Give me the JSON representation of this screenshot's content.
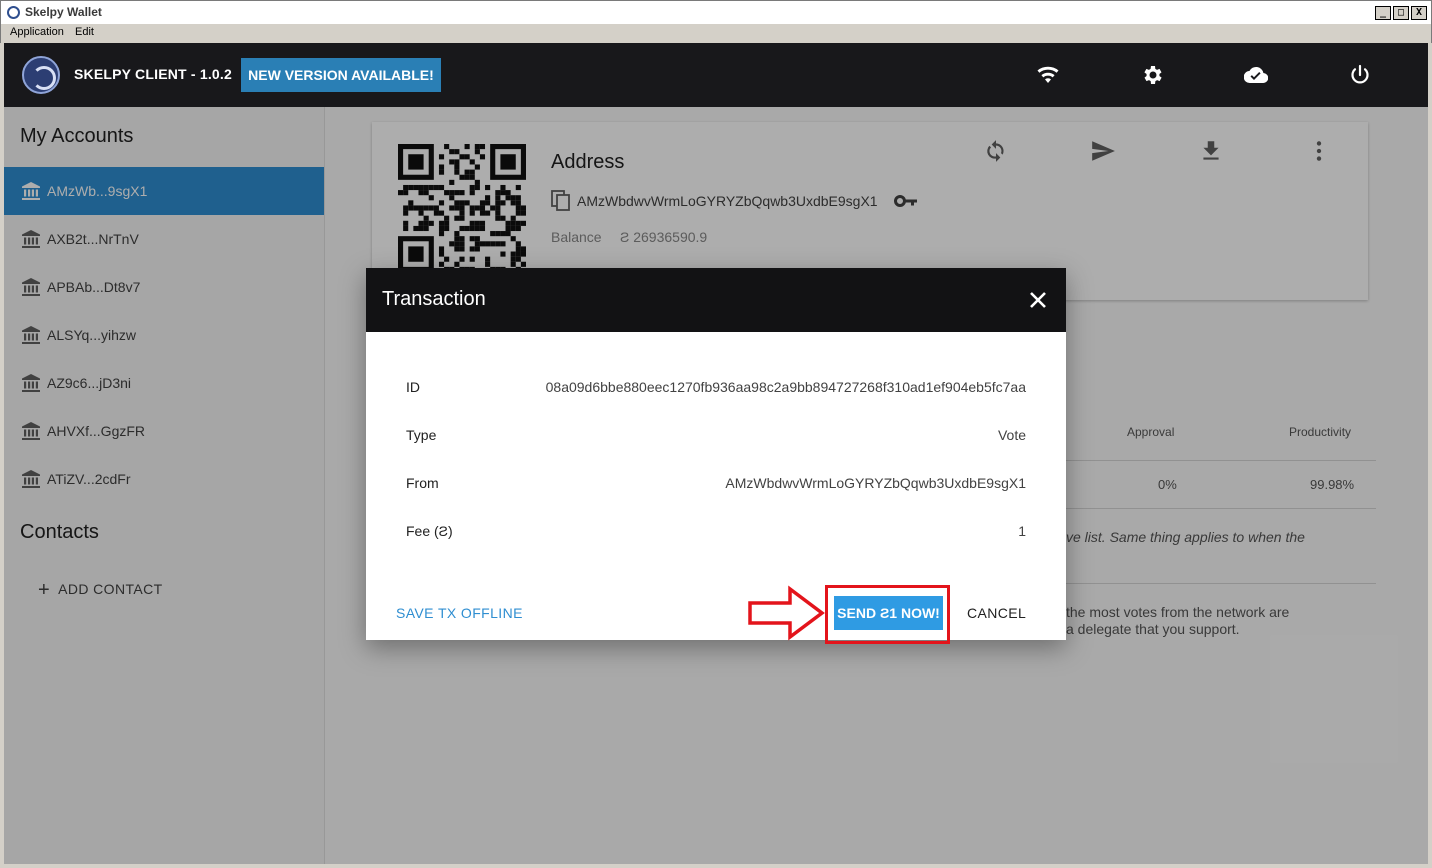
{
  "window": {
    "title": "Skelpy Wallet",
    "min": "_",
    "max": "□",
    "close": "X"
  },
  "menu": {
    "application": "Application",
    "edit": "Edit"
  },
  "header": {
    "title": "SKELPY CLIENT - 1.0.2",
    "new_version": "NEW VERSION AVAILABLE!"
  },
  "sidebar": {
    "accounts_heading": "My Accounts",
    "accounts": [
      {
        "label": "AMzWb...9sgX1",
        "active": true
      },
      {
        "label": "AXB2t...NrTnV"
      },
      {
        "label": "APBAb...Dt8v7"
      },
      {
        "label": "ALSYq...yihzw"
      },
      {
        "label": "AZ9c6...jD3ni"
      },
      {
        "label": "AHVXf...GgzFR"
      },
      {
        "label": "ATiZV...2cdFr"
      }
    ],
    "contacts_heading": "Contacts",
    "add_contact": "ADD CONTACT"
  },
  "card": {
    "title": "Address",
    "address": "AMzWbdwvWrmLoGYRYZbQqwb3UxdbE9sgX1",
    "balance_label": "Balance",
    "balance_value": "Ƨ 26936590.9"
  },
  "background": {
    "approval_header": "Approval",
    "productivity_header": "Productivity",
    "approval_value": "0%",
    "productivity_value": "99.98%",
    "note_1": "ve list. Same thing applies to when the",
    "note_2": "the most votes from the network are",
    "note_3": "a delegate that you support."
  },
  "dialog": {
    "title": "Transaction",
    "rows": [
      {
        "key": "ID",
        "value": "08a09d6bbe880eec1270fb936aa98c2a9bb894727268f310ad1ef904eb5fc7aa"
      },
      {
        "key": "Type",
        "value": "Vote"
      },
      {
        "key": "From",
        "value": "AMzWbdwvWrmLoGYRYZbQqwb3UxdbE9sgX1"
      },
      {
        "key": "Fee (Ƨ)",
        "value": "1"
      }
    ],
    "save_offline": "SAVE TX OFFLINE",
    "send_now": "SEND Ƨ1 NOW!",
    "cancel": "CANCEL"
  },
  "colors": {
    "accent": "#2f8ed1",
    "header_bg": "#18181b",
    "highlight": "#e3141b"
  }
}
